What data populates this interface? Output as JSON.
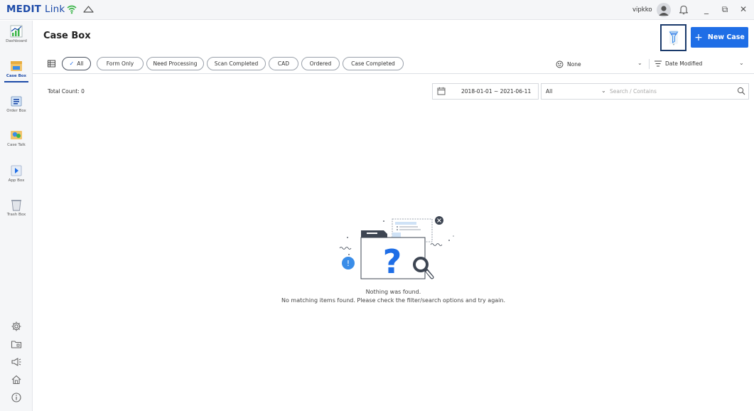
{
  "app": {
    "logo_bold": "MEDIT",
    "logo_light": "Link",
    "username": "vipkko",
    "accent_color": "#1f6ee6",
    "brand_color": "#1c4aa8"
  },
  "window_controls": {
    "minimize": "_",
    "restore": "⧉",
    "close": "✕"
  },
  "sidebar": {
    "items": [
      {
        "label": "Dashboard",
        "icon": "dashboard-icon"
      },
      {
        "label": "Case Box",
        "icon": "case-box-icon",
        "active": true
      },
      {
        "label": "Order Box",
        "icon": "order-box-icon"
      },
      {
        "label": "Case Talk",
        "icon": "case-talk-icon"
      },
      {
        "label": "App Box",
        "icon": "app-box-icon"
      },
      {
        "label": "Trash Box",
        "icon": "trash-box-icon"
      }
    ],
    "utilities": [
      "settings-icon",
      "folder-icon",
      "announcement-icon",
      "home-icon",
      "info-icon"
    ]
  },
  "header": {
    "title": "Case Box",
    "new_case_label": "New Case"
  },
  "filters": {
    "chips": [
      "All",
      "Form Only",
      "Need Processing",
      "Scan Completed",
      "CAD",
      "Ordered",
      "Case Completed"
    ],
    "selected": "All",
    "group_value": "None",
    "sort_value": "Date Modified"
  },
  "toolbar": {
    "total_count": "Total Count: 0",
    "date_range": "2018-01-01 ~ 2021-06-11",
    "search_scope": "All",
    "search_placeholder": "Search / Contains"
  },
  "empty_state": {
    "title": "Nothing was found.",
    "message": "No matching items found. Please check the filter/search options and try again."
  }
}
